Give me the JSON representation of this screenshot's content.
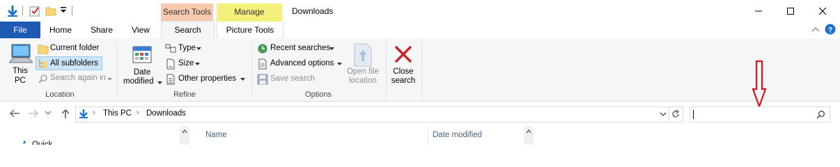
{
  "window": {
    "title": "Downloads",
    "context_search_tools": "Search Tools",
    "context_manage": "Manage"
  },
  "tabs": {
    "file": "File",
    "home": "Home",
    "share": "Share",
    "view": "View",
    "search": "Search",
    "picture_tools": "Picture Tools"
  },
  "ribbon": {
    "location": {
      "this_pc_line1": "This",
      "this_pc_line2": "PC",
      "current_folder": "Current folder",
      "all_subfolders": "All subfolders",
      "search_again_in": "Search again in",
      "label": "Location"
    },
    "refine": {
      "date_line1": "Date",
      "date_line2": "modified",
      "type": "Type",
      "size": "Size",
      "other_properties": "Other properties",
      "label": "Refine"
    },
    "options": {
      "recent_searches": "Recent searches",
      "advanced_options": "Advanced options",
      "save_search": "Save search",
      "open_file_line1": "Open file",
      "open_file_line2": "location",
      "label": "Options"
    },
    "close": {
      "line1": "Close",
      "line2": "search"
    }
  },
  "address": {
    "crumb1": "This PC",
    "crumb2": "Downloads",
    "search_value": ""
  },
  "list": {
    "col_name": "Name",
    "col_date": "Date modified",
    "sidebar_partial": "Quick"
  },
  "colors": {
    "file_tab": "#1e59b3",
    "search_tools": "#f9c9ad",
    "manage": "#f3f07b",
    "annotation_arrow": "#e0151a"
  }
}
